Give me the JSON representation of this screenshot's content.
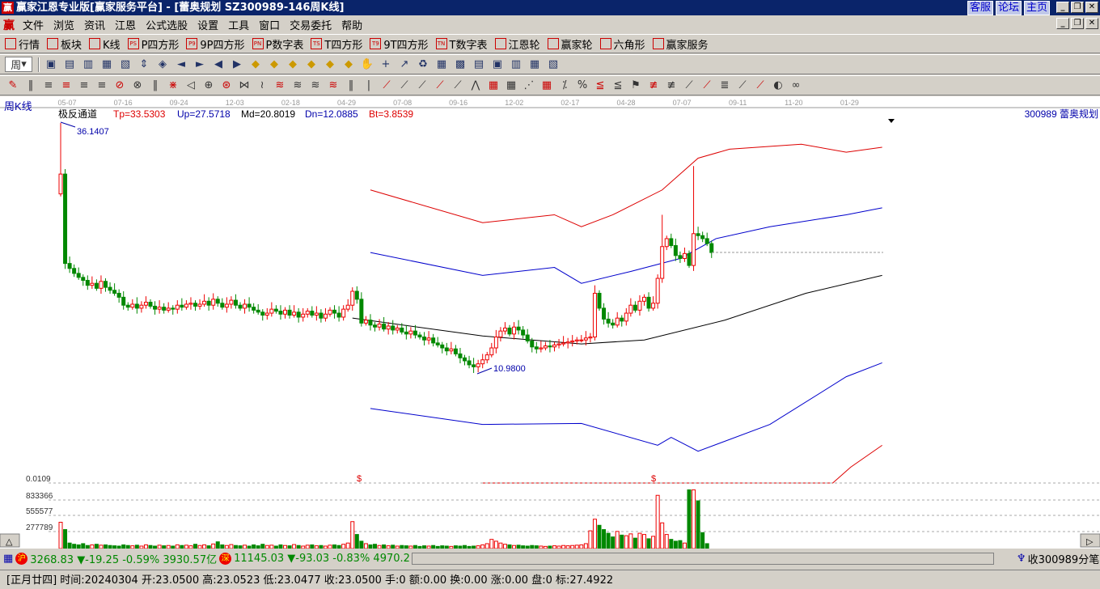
{
  "window": {
    "title": "赢家江恩专业版[赢家服务平台] - [蕾奥规划   SZ300989-146周K线]",
    "logo": "赢",
    "links": [
      "客服",
      "论坛",
      "主页"
    ]
  },
  "menu": [
    "文件",
    "浏览",
    "资讯",
    "江恩",
    "公式选股",
    "设置",
    "工具",
    "窗口",
    "交易委托",
    "帮助"
  ],
  "toolbar1": [
    {
      "icon": "grid",
      "label": "行情"
    },
    {
      "icon": "blocks",
      "label": "板块"
    },
    {
      "icon": "candles",
      "label": "K线"
    },
    {
      "icon": "PS",
      "label": "P四方形"
    },
    {
      "icon": "P9",
      "label": "9P四方形"
    },
    {
      "icon": "PN",
      "label": "P数字表"
    },
    {
      "icon": "TS",
      "label": "T四方形"
    },
    {
      "icon": "T9",
      "label": "9T四方形"
    },
    {
      "icon": "TN",
      "label": "T数字表"
    },
    {
      "icon": "wheel",
      "label": "江恩轮"
    },
    {
      "icon": "big",
      "label": "赢家轮"
    },
    {
      "icon": "hexagon",
      "label": "六角形"
    },
    {
      "icon": "dollar",
      "label": "赢家服务"
    }
  ],
  "period": "周",
  "chart_data": {
    "type": "candlestick",
    "title": "周K线",
    "indicator": {
      "name": "极反通道",
      "Tp": "Tp=33.5303",
      "Up": "Up=27.5718",
      "Md": "Md=20.8019",
      "Dn": "Dn=12.0885",
      "Bt": "Bt=3.8539"
    },
    "stock": "300989  蕾奥规划",
    "x_ticks": [
      "05-07",
      "07-16",
      "09-24",
      "12-03",
      "02-18",
      "04-29",
      "07-08",
      "09-16",
      "12-02",
      "02-17",
      "04-28",
      "07-07",
      "09-11",
      "11-20",
      "01-29"
    ],
    "high_label": "36.1407",
    "low_label": "10.9800",
    "closes": [
      31,
      22,
      21.5,
      21,
      20.6,
      20.3,
      19.8,
      20,
      19.5,
      20.2,
      19.6,
      19.3,
      19,
      18.6,
      17.8,
      17.6,
      17.9,
      17.5,
      17.8,
      18.1,
      17.7,
      17.4,
      17.6,
      17.3,
      17.5,
      17.4,
      17.8,
      17.6,
      17.9,
      18.0,
      17.7,
      17.9,
      18.2,
      17.8,
      18.4,
      18.0,
      17.6,
      17.9,
      18.3,
      17.8,
      17.5,
      17.9,
      17.6,
      17.3,
      17.1,
      16.8,
      17.0,
      17.4,
      17.2,
      16.9,
      17.3,
      16.8,
      17.1,
      16.6,
      16.9,
      17.2,
      16.8,
      17.0,
      16.5,
      16.9,
      17.3,
      17.0,
      16.6,
      17.4,
      17.8,
      19.2,
      18.4,
      16.0,
      16.3,
      15.8,
      15.6,
      15.9,
      15.4,
      15.7,
      15.3,
      15.5,
      15.1,
      14.9,
      15.2,
      14.8,
      14.6,
      14.3,
      14.5,
      14.0,
      13.8,
      13.5,
      13.2,
      13.4,
      12.9,
      12.5,
      12.2,
      11.8,
      11.6,
      11.9,
      12.3,
      12.8,
      13.5,
      14.6,
      15.2,
      15.5,
      14.9,
      15.6,
      15.3,
      14.8,
      14.2,
      13.6,
      13.4,
      13.5,
      13.7,
      13.6,
      13.8,
      13.9,
      14.0,
      14.1,
      14.2,
      14.3,
      14.3,
      14.5,
      14.6,
      19.0,
      17.5,
      16.4,
      16.0,
      15.8,
      16.5,
      16.2,
      17.0,
      17.8,
      17.3,
      18.2,
      18.6,
      17.5,
      18.0,
      20.5,
      23.7,
      24.5,
      23.8,
      22.8,
      22.5,
      23.0,
      21.8,
      25.0,
      24.8,
      24.5,
      24.0,
      23.1
    ],
    "first_open": 29,
    "volumes": [
      430,
      310,
      90,
      70,
      60,
      80,
      50,
      60,
      70,
      55,
      60,
      50,
      45,
      40,
      60,
      50,
      45,
      55,
      40,
      60,
      50,
      40,
      55,
      45,
      50,
      40,
      60,
      50,
      55,
      45,
      70,
      50,
      60,
      45,
      75,
      110,
      60,
      50,
      65,
      50,
      45,
      55,
      40,
      60,
      45,
      70,
      50,
      55,
      40,
      60,
      50,
      45,
      65,
      50,
      40,
      55,
      60,
      45,
      50,
      40,
      55,
      60,
      50,
      70,
      90,
      440,
      230,
      120,
      80,
      60,
      70,
      50,
      60,
      45,
      55,
      40,
      50,
      45,
      40,
      50,
      35,
      45,
      40,
      50,
      35,
      45,
      40,
      35,
      45,
      40,
      50,
      35,
      40,
      45,
      60,
      80,
      150,
      120,
      90,
      70,
      60,
      50,
      55,
      45,
      40,
      50,
      45,
      40,
      35,
      40,
      45,
      40,
      50,
      45,
      50,
      55,
      60,
      80,
      290,
      480,
      380,
      310,
      250,
      190,
      280,
      220,
      210,
      240,
      170,
      250,
      230,
      160,
      200,
      870,
      420,
      230,
      150,
      120,
      130,
      90,
      960,
      960,
      780,
      260,
      80
    ],
    "channels": {
      "Tp": [
        [
          69,
          29.4
        ],
        [
          94,
          26.1
        ],
        [
          110,
          26.9
        ],
        [
          116,
          25.7
        ],
        [
          123,
          26.9
        ],
        [
          134,
          29.4
        ],
        [
          142,
          32.6
        ],
        [
          149,
          33.5
        ],
        [
          165,
          34.0
        ],
        [
          175,
          33.2
        ],
        [
          183,
          33.7
        ]
      ],
      "Up": [
        [
          69,
          23.1
        ],
        [
          94,
          20.8
        ],
        [
          110,
          21.6
        ],
        [
          116,
          20.0
        ],
        [
          127,
          21.2
        ],
        [
          138,
          22.5
        ],
        [
          146,
          24.5
        ],
        [
          158,
          25.7
        ],
        [
          175,
          26.9
        ],
        [
          183,
          27.6
        ]
      ],
      "Md": [
        [
          65,
          16.5
        ],
        [
          94,
          14.7
        ],
        [
          116,
          13.9
        ],
        [
          130,
          14.3
        ],
        [
          148,
          16.3
        ],
        [
          166,
          19.0
        ],
        [
          183,
          20.8
        ]
      ],
      "Dn": [
        [
          69,
          7.4
        ],
        [
          94,
          5.8
        ],
        [
          116,
          5.9
        ],
        [
          133,
          3.7
        ],
        [
          136,
          4.5
        ],
        [
          142,
          3.1
        ],
        [
          158,
          5.8
        ],
        [
          175,
          10.6
        ],
        [
          183,
          12.0
        ]
      ],
      "Bt": [
        [
          94,
          -0.5
        ],
        [
          172,
          -0.5
        ],
        [
          176,
          1.5
        ],
        [
          183,
          3.7
        ]
      ]
    },
    "volume_ticks": [
      "0.0109",
      "833366",
      "555577",
      "277789"
    ],
    "markers": [
      "$",
      "$"
    ]
  },
  "status1": {
    "sh_badge": "沪",
    "sh": "3268.83 ▼-19.25 -0.59% 3930.57亿",
    "sz_badge": "深",
    "sz": "11145.03 ▼-93.03 -0.83% 4970.2",
    "tick": "收300989分笔"
  },
  "status2": "[正月廿四] 时间:20240304 开:23.0500 高:23.0523 低:23.0477 收:23.0500 手:0 额:0.00 换:0.00 涨:0.00 盘:0 标:27.4922"
}
